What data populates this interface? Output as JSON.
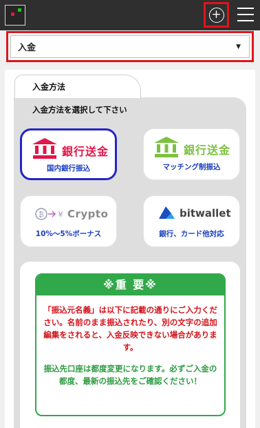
{
  "header": {
    "plus_icon": "plus-circle-icon",
    "menu_icon": "hamburger-icon"
  },
  "dropdown": {
    "selected": "入金"
  },
  "tab": {
    "label": "入金方法"
  },
  "subtitle": "入金方法を選択して下さい",
  "methods": [
    {
      "logo_text": "銀行送金",
      "caption": "国内銀行振込",
      "color": "#e0174a",
      "selected": true
    },
    {
      "logo_text": "銀行送金",
      "caption": "マッチング制振込",
      "color": "#7cc242",
      "selected": false
    },
    {
      "logo_text": "Crypto",
      "caption": "10%～5%ボーナス",
      "color": "#1a3fc0",
      "selected": false
    },
    {
      "logo_text": "bitwallet",
      "caption": "銀行、カード他対応",
      "color": "#1a3fc0",
      "selected": false
    }
  ],
  "notice": {
    "title": "※重 要※",
    "warning": "「振込元名義」は以下に記載の通りにご入力ください。名前のまま振込されたり、別の文字の追加編集をされると、入金反映できない場合があります。",
    "info": "振込先口座は都度変更になります。必ずご入金の都度、最新の振込先をご確認ください！"
  },
  "colors": {
    "accent_red": "#e0141b",
    "selected_border": "#2424c8",
    "notice_green": "#31a84a"
  }
}
